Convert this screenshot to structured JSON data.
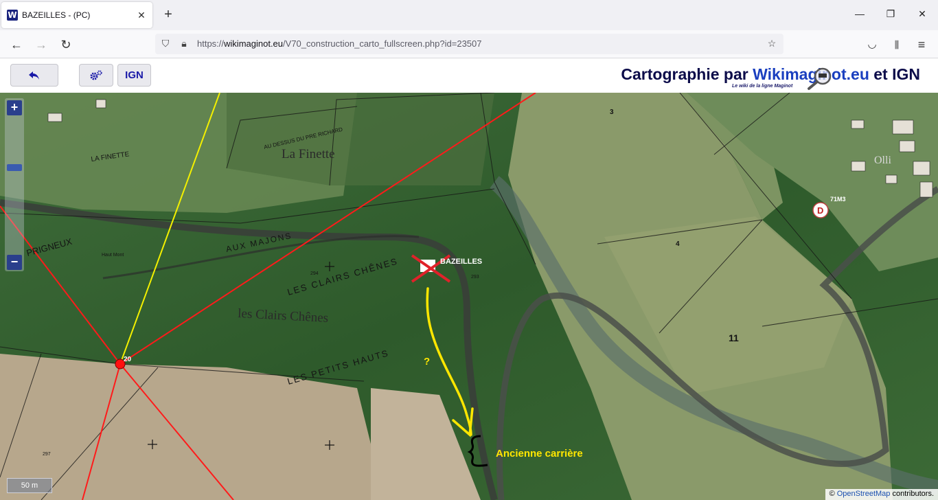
{
  "browser": {
    "tab_title": "BAZEILLES - (PC)",
    "tab_favicon_letter": "W",
    "url_prefix": "https://",
    "url_host": "wikimaginot.eu",
    "url_path": "/V70_construction_carto_fullscreen.php?id=23507"
  },
  "app": {
    "ign_label": "IGN",
    "brand_prefix": "Cartographie par ",
    "brand_site": "Wikimaginot.eu",
    "brand_suffix": " et IGN",
    "brand_tagline": "Le wiki de la ligne Maginot"
  },
  "map": {
    "place_labels": {
      "la_finette_small": "LA FINETTE",
      "au_dessus_du_pre_richard": "AU DESSUS DU PRE RICHARD",
      "la_finette": "La Finette",
      "prigneux": "PRIGNEUX",
      "aux_majons": "AUX MAJONS",
      "les_clairs_chenes_caps": "LES CLAIRS CHÊNES",
      "les_clairs_chenes": "les Clairs Chênes",
      "les_petits_hauts": "LES PETITS HAUTS",
      "haut_mont": "Haut Mont"
    },
    "parcel_numbers": [
      "3",
      "4",
      "11",
      "71M3",
      "Olli",
      "293",
      "294",
      "297"
    ],
    "marker_bazeilles_label": "BAZEILLES",
    "marker_20_label": "20",
    "marker_d_label": "D",
    "annotation_question": "?",
    "annotation_quarry": "Ancienne carrière",
    "scale_label": "50 m",
    "attribution_symbol": "©",
    "attribution_link": "OpenStreetMap",
    "attribution_suffix": "contributors."
  },
  "colors": {
    "brand_dark": "#0c0c4a",
    "brand_blue": "#1a3fbf",
    "red_line": "#ff1a1a",
    "yellow_line": "#f4f000",
    "annotation_yellow": "#ffe600"
  }
}
